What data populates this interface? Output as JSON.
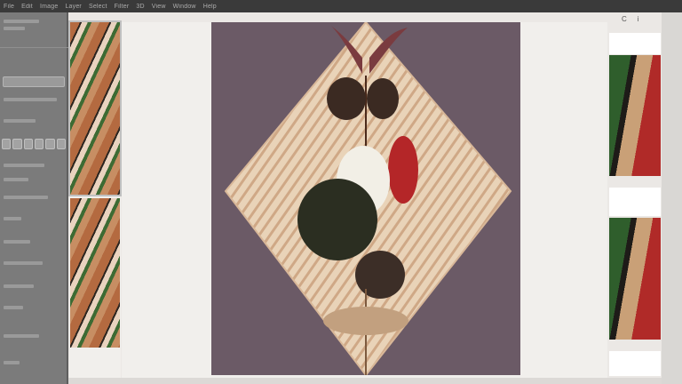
{
  "menubar": {
    "items": [
      "File",
      "Edit",
      "Image",
      "Layer",
      "Select",
      "Filter",
      "3D",
      "View",
      "Window",
      "Help"
    ]
  },
  "window_controls": {
    "refresh": "C",
    "info": "i"
  },
  "colors": {
    "menubar_bg": "#3a3a3a",
    "panel_bg": "#7b7b7b",
    "canvas_bg": "#f1efec",
    "artwork_bg": "#6b5a66",
    "accent_red": "#b02a28"
  },
  "icons": {
    "refresh": "refresh-icon",
    "info": "info-icon"
  }
}
